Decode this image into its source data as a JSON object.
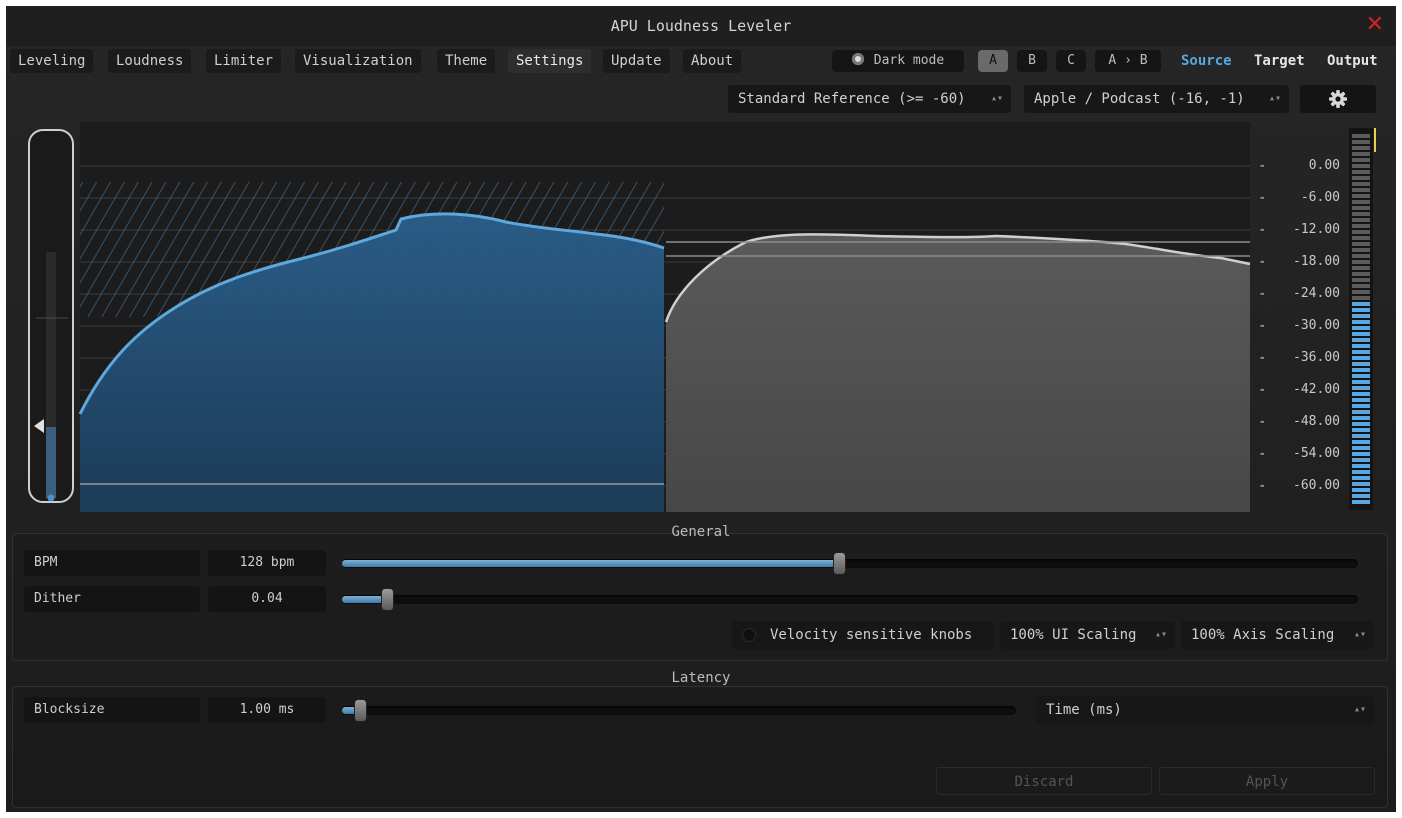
{
  "window": {
    "title": "APU Loudness Leveler",
    "close_glyph": "✕"
  },
  "tabs": [
    {
      "label": "Leveling",
      "active": false
    },
    {
      "label": "Loudness",
      "active": false
    },
    {
      "label": "Limiter",
      "active": false
    },
    {
      "label": "Visualization",
      "active": false
    },
    {
      "label": "Theme",
      "active": false
    },
    {
      "label": "Settings",
      "active": true
    },
    {
      "label": "Update",
      "active": false
    },
    {
      "label": "About",
      "active": false
    }
  ],
  "toolbar": {
    "dark_mode_label": "Dark mode",
    "presets": [
      "A",
      "B",
      "C"
    ],
    "active_preset": "A",
    "copy_label": "A › B",
    "source_label": "Source",
    "target_label": "Target",
    "output_label": "Output",
    "accent_color": "#5aa6e0"
  },
  "selectors": {
    "reference": "Standard Reference (>= -60)",
    "target_preset": "Apple / Podcast (-16, -1)"
  },
  "meter_scale": {
    "ticks": [
      "0.00",
      "-6.00",
      "-12.00",
      "-18.00",
      "-24.00",
      "-30.00",
      "-36.00",
      "-42.00",
      "-48.00",
      "-54.00",
      "-60.00"
    ],
    "level_meter_fraction": 0.55
  },
  "general": {
    "title": "General",
    "bpm_label": "BPM",
    "bpm_value": "128 bpm",
    "bpm_fraction": 0.49,
    "dither_label": "Dither",
    "dither_value": "0.04",
    "dither_fraction": 0.04,
    "velocity_label": "Velocity sensitive knobs",
    "ui_scaling": "100% UI Scaling",
    "axis_scaling": "100% Axis Scaling"
  },
  "latency": {
    "title": "Latency",
    "blocksize_label": "Blocksize",
    "blocksize_value": "1.00 ms",
    "blocksize_fraction": 0.02,
    "unit_select": "Time (ms)"
  },
  "actions": {
    "discard": "Discard",
    "apply": "Apply"
  },
  "glyphs": {
    "updown": "▴▾"
  }
}
